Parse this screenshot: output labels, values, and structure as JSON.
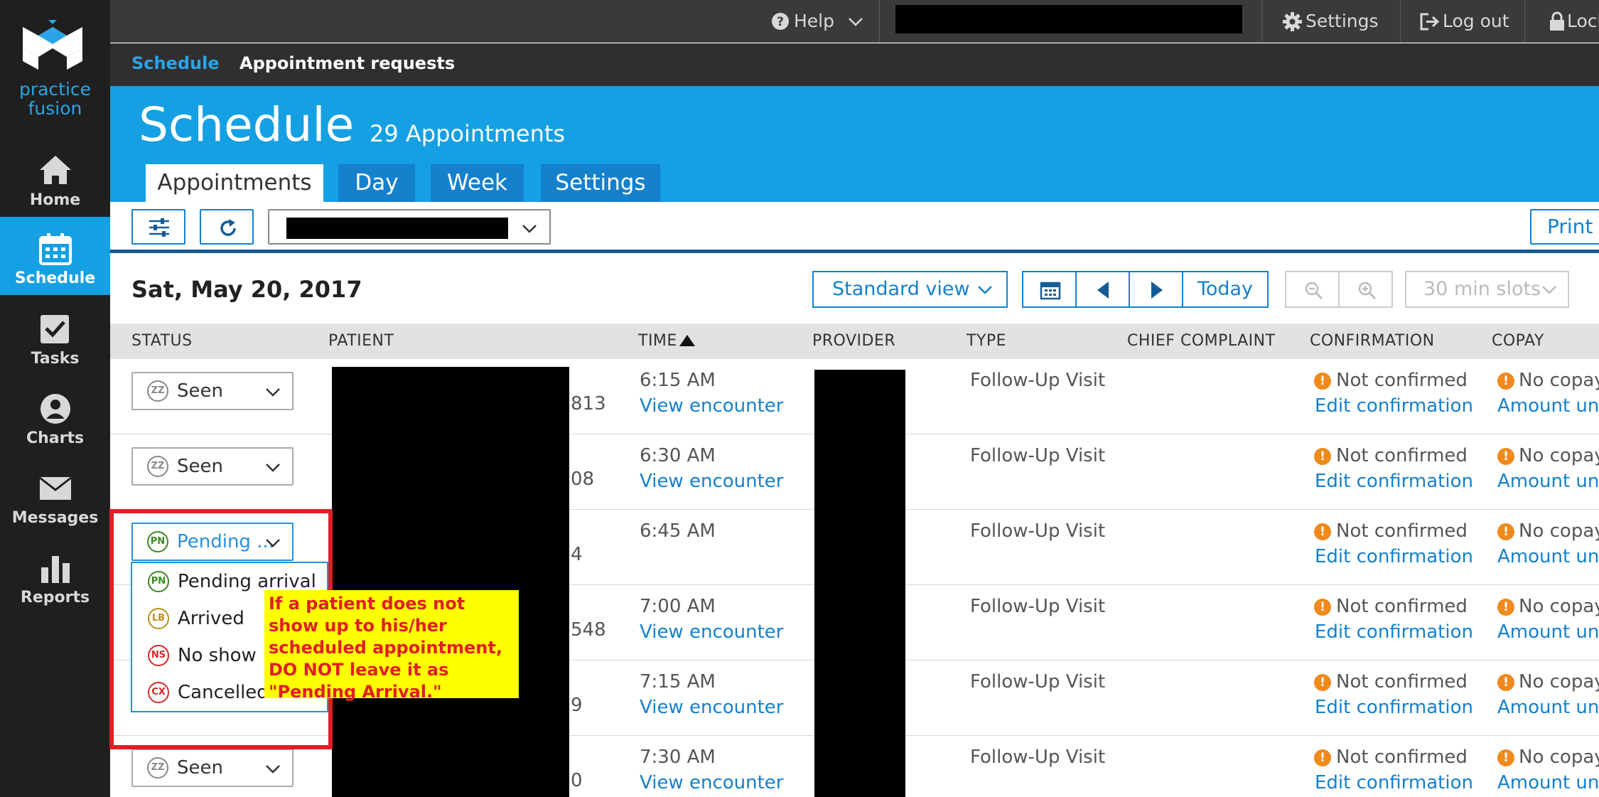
{
  "sidebar": {
    "logo_line1": "practice",
    "logo_line2": "fusion",
    "items": [
      {
        "label": "Home"
      },
      {
        "label": "Schedule"
      },
      {
        "label": "Tasks"
      },
      {
        "label": "Charts"
      },
      {
        "label": "Messages"
      },
      {
        "label": "Reports"
      }
    ],
    "active_color": "#15a0e3"
  },
  "topbar": {
    "help": "Help",
    "settings": "Settings",
    "logout": "Log out",
    "lock": "Lock"
  },
  "subnav": {
    "schedule": "Schedule",
    "requests": "Appointment requests"
  },
  "header": {
    "title": "Schedule",
    "count": "29 Appointments",
    "tabs": [
      "Appointments",
      "Day",
      "Week",
      "Settings"
    ]
  },
  "toolbar": {
    "print": "Print"
  },
  "date": "Sat, May 20, 2017",
  "controls": {
    "view": "Standard view",
    "today": "Today",
    "slots": "30 min slots"
  },
  "columns": [
    "STATUS",
    "PATIENT",
    "TIME",
    "PROVIDER",
    "TYPE",
    "CHIEF COMPLAINT",
    "CONFIRMATION",
    "COPAY"
  ],
  "rows": [
    {
      "status": "Seen",
      "badge": "ZZ",
      "patient_tail": "813",
      "time": "6:15 AM",
      "encounter": "View encounter",
      "type": "Follow-Up Visit",
      "confirmation": "Not confirmed",
      "edit": "Edit confirmation",
      "copay": "No copay",
      "amount": "Amount unk"
    },
    {
      "status": "Seen",
      "badge": "ZZ",
      "patient_tail": "08",
      "time": "6:30 AM",
      "encounter": "View encounter",
      "type": "Follow-Up Visit",
      "confirmation": "Not confirmed",
      "edit": "Edit confirmation",
      "copay": "No copay",
      "amount": "Amount unk"
    },
    {
      "status": "Pending ...",
      "badge": "PN",
      "patient_tail": "4",
      "time": "6:45 AM",
      "encounter": "",
      "type": "Follow-Up Visit",
      "confirmation": "Not confirmed",
      "edit": "Edit confirmation",
      "copay": "No copay",
      "amount": "Amount unk"
    },
    {
      "status": "",
      "badge": "",
      "patient_tail": "548",
      "time": "7:00 AM",
      "encounter": "View encounter",
      "type": "Follow-Up Visit",
      "confirmation": "Not confirmed",
      "edit": "Edit confirmation",
      "copay": "No copay",
      "amount": "Amount unk"
    },
    {
      "status": "",
      "badge": "",
      "patient_tail": "9",
      "time": "7:15 AM",
      "encounter": "View encounter",
      "type": "Follow-Up Visit",
      "confirmation": "Not confirmed",
      "edit": "Edit confirmation",
      "copay": "No copay",
      "amount": "Amount unk"
    },
    {
      "status": "Seen",
      "badge": "ZZ",
      "patient_tail": "0",
      "time": "7:30 AM",
      "encounter": "View encounter",
      "type": "Follow-Up Visit",
      "confirmation": "Not confirmed",
      "edit": "Edit confirmation",
      "copay": "No copay",
      "amount": "Amount unk"
    }
  ],
  "status_menu": [
    {
      "badge": "PN",
      "label": "Pending arrival",
      "color": "#3a8a1e"
    },
    {
      "badge": "LB",
      "label": "Arrived",
      "color": "#b8901a"
    },
    {
      "badge": "NS",
      "label": "No show",
      "color": "#d42a2a"
    },
    {
      "badge": "CX",
      "label": "Cancelled",
      "color": "#d42a2a"
    }
  ],
  "annotation": "If a patient does not show up to his/her scheduled appointment, DO NOT leave it as \"Pending Arrival.\""
}
